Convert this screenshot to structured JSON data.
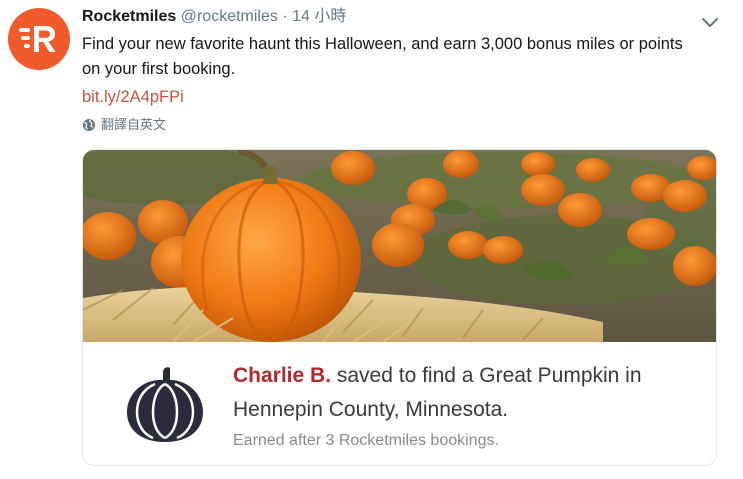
{
  "tweet": {
    "display_name": "Rocketmiles",
    "handle": "@rocketmiles",
    "separator": "·",
    "time": "14 小時",
    "text": "Find your new favorite haunt this Halloween, and earn 3,000 bonus miles or points on your first booking.",
    "link": "bit.ly/2A4pFPi",
    "translate_label": "翻譯自英文",
    "avatar_letter": "R",
    "avatar_color": "#f15a2b"
  },
  "card": {
    "name": "Charlie B.",
    "line1_rest": " saved to find a Great Pumpkin in",
    "line2": "Hennepin County, Minnesota.",
    "footnote": "Earned after 3 Rocketmiles bookings.",
    "name_color": "#b5282f",
    "image_icon": "pumpkin-patch-photo",
    "badge_icon": "pumpkin-icon"
  },
  "icons": {
    "caret": "chevron-down-icon",
    "globe": "globe-icon"
  }
}
